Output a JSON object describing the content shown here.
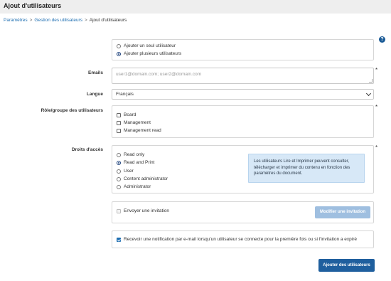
{
  "header": {
    "title": "Ajout d'utilisateurs"
  },
  "breadcrumb": {
    "items": [
      "Paramètres",
      "Gestion des utilisateurs",
      "Ajout d'utilisateurs"
    ],
    "separator": ">"
  },
  "help": {
    "glyph": "?"
  },
  "mode": {
    "options": [
      {
        "label": "Ajouter un seul utilisateur",
        "selected": false
      },
      {
        "label": "Ajouter plusieurs utilisateurs",
        "selected": true
      }
    ]
  },
  "emails": {
    "label": "Emails",
    "placeholder": "user1@domain.com; user2@domain.com",
    "required": "*"
  },
  "language": {
    "label": "Langue",
    "value": "Français"
  },
  "roles": {
    "label": "Rôle/groupe des utilisateurs",
    "required": "*",
    "items": [
      {
        "label": "Board",
        "checked": false
      },
      {
        "label": "Management",
        "checked": false
      },
      {
        "label": "Management read",
        "checked": false
      }
    ]
  },
  "rights": {
    "label": "Droits d'accès",
    "required": "*",
    "options": [
      {
        "label": "Read only",
        "selected": false
      },
      {
        "label": "Read and Print",
        "selected": true
      },
      {
        "label": "User",
        "selected": false
      },
      {
        "label": "Content administrator",
        "selected": false
      },
      {
        "label": "Administrator",
        "selected": false
      }
    ],
    "info": "Les utilisateurs Lire et Imprimer peuvent consulter, télécharger et imprimer du contenu en fonction des paramètres du document."
  },
  "invitation": {
    "label": "Envoyer une invitation",
    "checked": false,
    "button": "Modifier une invitation"
  },
  "notification": {
    "label": "Recevoir une notification par e-mail lorsqu'un utilisateur se connecte pour la première fois ou si l'invitation a expiré",
    "checked": true
  },
  "submit": {
    "label": "Ajouter des utilisateurs"
  },
  "colors": {
    "accent": "#1f5f9e",
    "info_bg": "#d7e8f7",
    "header_bg": "#eeeeee"
  }
}
